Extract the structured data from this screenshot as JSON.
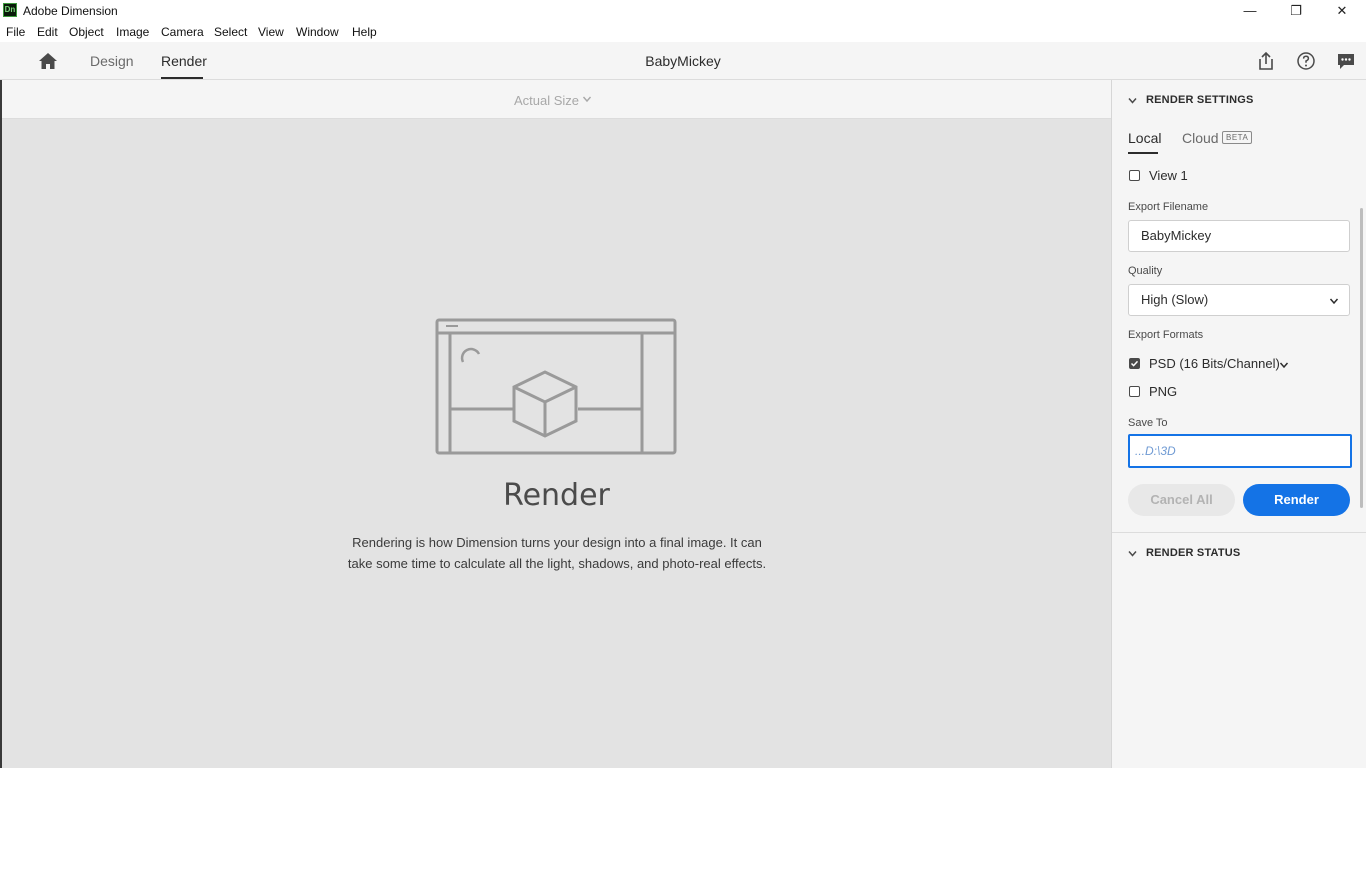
{
  "window": {
    "app_icon_text": "Dn",
    "title": "Adobe Dimension",
    "min_glyph": "—",
    "max_glyph": "❐",
    "close_glyph": "✕"
  },
  "menu": [
    "File",
    "Edit",
    "Object",
    "Image",
    "Camera",
    "Select",
    "View",
    "Window",
    "Help"
  ],
  "nav": {
    "tabs": [
      {
        "label": "Design"
      },
      {
        "label": "Render"
      }
    ],
    "active_tab": "Render",
    "document_title": "BabyMickey",
    "icons": [
      "home-icon",
      "share-icon",
      "help-icon",
      "feedback-icon"
    ]
  },
  "canvas": {
    "zoom_label": "Actual Size",
    "heading": "Render",
    "description_line1": "Rendering is how Dimension turns your design into a final image. It can",
    "description_line2": "take some time to calculate all the light, shadows, and photo-real effects."
  },
  "render_settings": {
    "header": "RENDER SETTINGS",
    "tabs": [
      {
        "label": "Local"
      },
      {
        "label": "Cloud"
      }
    ],
    "active_tab": "Local",
    "beta_badge": "BETA",
    "views": [
      {
        "label": "View 1",
        "checked": false
      }
    ],
    "export_filename_label": "Export Filename",
    "export_filename_value": "BabyMickey",
    "quality_label": "Quality",
    "quality_value": "High (Slow)",
    "export_formats_label": "Export Formats",
    "formats": [
      {
        "label": "PSD (16 Bits/Channel)",
        "checked": true
      },
      {
        "label": "PNG",
        "checked": false
      }
    ],
    "save_to_label": "Save To",
    "save_to_value": "...D:\\3D",
    "cancel_button": "Cancel All",
    "render_button": "Render"
  },
  "render_status": {
    "header": "RENDER STATUS"
  },
  "colors": {
    "accent": "#1473e6",
    "canvas_bg": "#e3e3e3",
    "panel_bg": "#f5f5f5"
  }
}
